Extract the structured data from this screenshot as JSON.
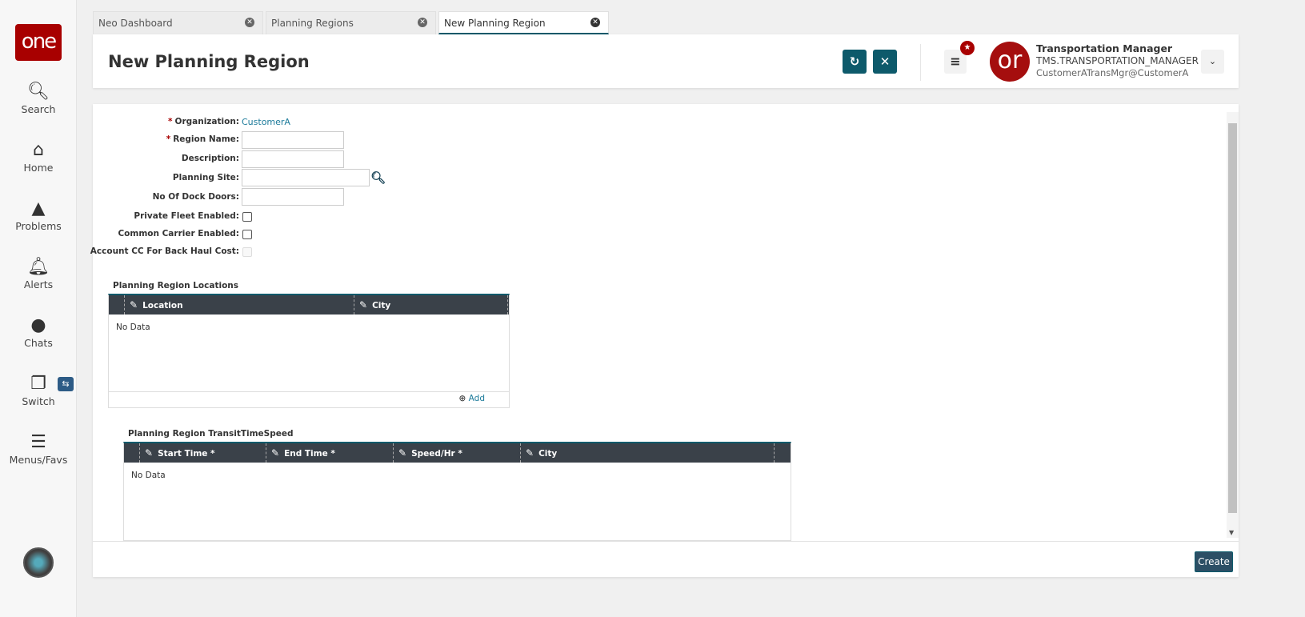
{
  "sidebar": {
    "logo": "one",
    "items": [
      {
        "label": "Search",
        "icon": "search-icon"
      },
      {
        "label": "Home",
        "icon": "home-icon"
      },
      {
        "label": "Problems",
        "icon": "warning-icon"
      },
      {
        "label": "Alerts",
        "icon": "bell-icon"
      },
      {
        "label": "Chats",
        "icon": "chat-icon"
      },
      {
        "label": "Switch",
        "icon": "switch-icon"
      },
      {
        "label": "Menus/Favs",
        "icon": "menu-icon"
      }
    ]
  },
  "tabs": [
    {
      "label": "Neo Dashboard"
    },
    {
      "label": "Planning Regions"
    },
    {
      "label": "New Planning Region",
      "active": true
    }
  ],
  "header": {
    "title": "New Planning Region",
    "user": {
      "name": "Transportation Manager",
      "role": "TMS.TRANSPORTATION_MANAGER",
      "email": "CustomerATransMgr@CustomerA",
      "avatar": "or"
    }
  },
  "form": {
    "organization_label": "Organization:",
    "organization_value": "CustomerA",
    "region_name_label": "Region Name:",
    "region_name_value": "",
    "description_label": "Description:",
    "description_value": "",
    "planning_site_label": "Planning Site:",
    "planning_site_value": "",
    "dock_doors_label": "No Of Dock Doors:",
    "dock_doors_value": "",
    "private_fleet_label": "Private Fleet Enabled:",
    "private_fleet": false,
    "common_carrier_label": "Common Carrier Enabled:",
    "common_carrier": false,
    "account_cc_label": "Account CC For Back Haul Cost:",
    "account_cc": false,
    "required_mark": "*"
  },
  "locations": {
    "title": "Planning Region Locations",
    "columns": [
      "Location",
      "City"
    ],
    "empty": "No Data",
    "add_label": "Add"
  },
  "transit": {
    "title": "Planning Region TransitTimeSpeed",
    "columns": [
      "Start Time *",
      "End Time *",
      "Speed/Hr *",
      "City"
    ],
    "empty": "No Data"
  },
  "footer": {
    "create_label": "Create"
  }
}
